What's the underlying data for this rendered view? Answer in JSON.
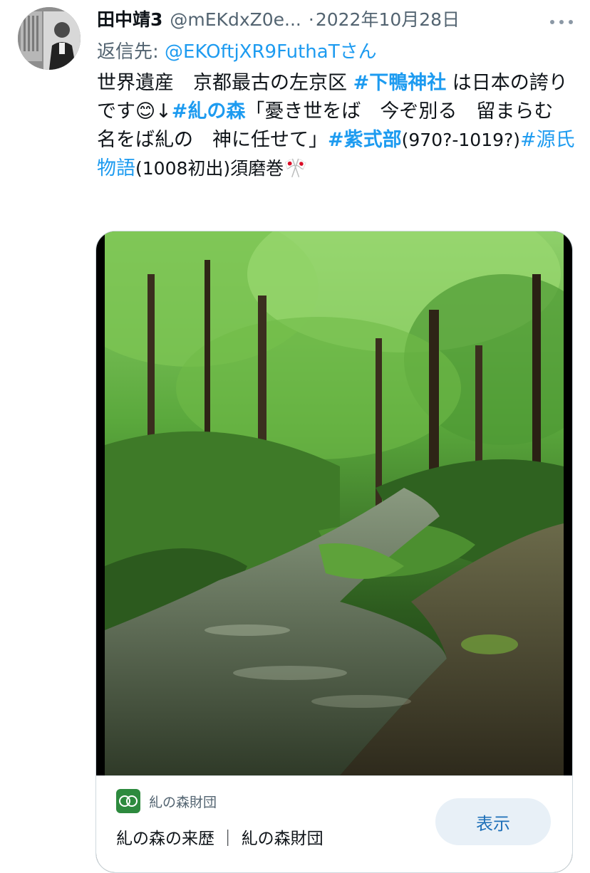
{
  "tweet": {
    "author_name": "田中靖3",
    "author_handle": "@mEKdxZ0e...",
    "separator": "·",
    "date": "2022年10月28日",
    "reply_label": "返信先: ",
    "reply_to": "@EKOftjXR9FuthaTさん",
    "text": {
      "p1": "世界遺産　京都最古の左京区 ",
      "tag1": "#下鴨神社",
      "p2": " は日本の誇りです",
      "emoji1": "😊",
      "p3": "↓",
      "tag2": "#糺の森",
      "p4": "「憂き世をば　今ぞ別る　留まらむ　名をば糺の　神に任せて」",
      "tag3": "#紫式部",
      "p5": "(970?-1019?)",
      "tag4": "#源氏物語",
      "p6": "(1008初出)須磨巻",
      "emoji2": "🎌"
    }
  },
  "card": {
    "site_name": "糺の森財団",
    "title": "糺の森の来歴 ｜ 糺の森財団",
    "button_label": "表示"
  },
  "icons": {
    "more": "more-options-icon",
    "site": "tadasu-no-mori-logo-icon"
  },
  "colors": {
    "link": "#1d9bf0",
    "secondary_text": "#536471",
    "button_bg": "#e8f0f7"
  }
}
